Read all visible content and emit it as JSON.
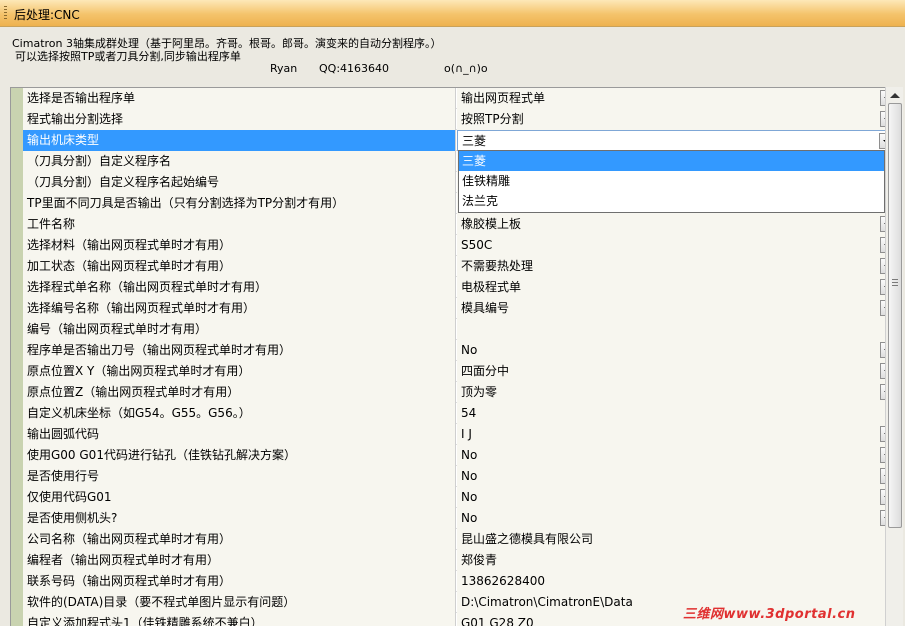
{
  "window": {
    "title": "后处理:CNC"
  },
  "description": {
    "line1": "Cimatron 3轴集成群处理（基于阿里昂。齐哥。根哥。郎哥。演变来的自动分割程序。）",
    "line2": "可以选择按照TP或者刀具分割,同步输出程序单",
    "author": "Ryan",
    "qq": "QQ:4163640",
    "emoticon": "o(∩_∩)o"
  },
  "properties": [
    {
      "name": "选择是否输出程序单",
      "value": "输出网页程式单",
      "dropdown": true
    },
    {
      "name": "程式输出分割选择",
      "value": "按照TP分割",
      "dropdown": true
    },
    {
      "name": "输出机床类型",
      "value": "三菱",
      "dropdown": true
    },
    {
      "name": "（刀具分割）自定义程序名",
      "value": "",
      "dropdown": false
    },
    {
      "name": "（刀具分割）自定义程序名起始编号",
      "value": "",
      "dropdown": false
    },
    {
      "name": "TP里面不同刀具是否输出（只有分割选择为TP分割才有用）",
      "value": "",
      "dropdown": false
    },
    {
      "name": "工件名称",
      "value": "橡胶模上板",
      "dropdown": true
    },
    {
      "name": "选择材料（输出网页程式单时才有用）",
      "value": "S50C",
      "dropdown": true
    },
    {
      "name": "加工状态（输出网页程式单时才有用）",
      "value": "不需要热处理",
      "dropdown": true
    },
    {
      "name": "选择程式单名称（输出网页程式单时才有用）",
      "value": "电极程式单",
      "dropdown": true
    },
    {
      "name": "选择编号名称（输出网页程式单时才有用）",
      "value": "模具编号",
      "dropdown": true
    },
    {
      "name": "编号（输出网页程式单时才有用）",
      "value": "",
      "dropdown": false
    },
    {
      "name": "程序单是否输出刀号（输出网页程式单时才有用）",
      "value": "No",
      "dropdown": true
    },
    {
      "name": "原点位置X Y（输出网页程式单时才有用）",
      "value": "四面分中",
      "dropdown": true
    },
    {
      "name": "原点位置Z（输出网页程式单时才有用）",
      "value": "顶为零",
      "dropdown": true
    },
    {
      "name": "自定义机床坐标（如G54。G55。G56。）",
      "value": "54",
      "dropdown": false
    },
    {
      "name": "输出圆弧代码",
      "value": "I J",
      "dropdown": true
    },
    {
      "name": "使用G00 G01代码进行钻孔（佳铁钻孔解决方案）",
      "value": "No",
      "dropdown": true
    },
    {
      "name": "是否使用行号",
      "value": "No",
      "dropdown": true
    },
    {
      "name": "仅使用代码G01",
      "value": "No",
      "dropdown": true
    },
    {
      "name": "是否使用侧机头?",
      "value": "No",
      "dropdown": true
    },
    {
      "name": "公司名称（输出网页程式单时才有用）",
      "value": "昆山盛之德模具有限公司",
      "dropdown": false
    },
    {
      "name": "编程者（输出网页程式单时才有用）",
      "value": "郑俊青",
      "dropdown": false
    },
    {
      "name": "联系号码（输出网页程式单时才有用）",
      "value": "13862628400",
      "dropdown": false
    },
    {
      "name": "软件的(DATA)目录（要不程式单图片显示有问题）",
      "value": "D:\\Cimatron\\CimatronE\\Data",
      "dropdown": false
    },
    {
      "name": "自定义添加程式头1（佳铁精雕系统不兼白）",
      "value": "G01 G28 Z0",
      "dropdown": false
    }
  ],
  "open_dropdown": {
    "options": [
      "三菱",
      "佳铁精雕",
      "法兰克"
    ],
    "highlighted": 0
  },
  "watermark": "三维网www.3dportal.cn",
  "colors": {
    "selection": "#3399ff",
    "titlebar": "#f4c36b",
    "watermark": "#e03030"
  }
}
